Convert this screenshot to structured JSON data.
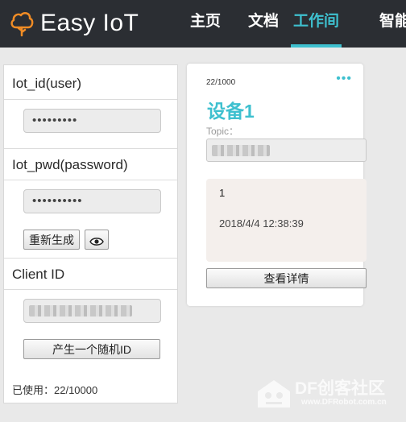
{
  "app": {
    "name": "Easy IoT"
  },
  "nav": {
    "items": [
      {
        "label": "主页"
      },
      {
        "label": "文档"
      },
      {
        "label": "工作间",
        "active": true
      },
      {
        "label": "智能"
      }
    ]
  },
  "credentials": {
    "iot_id_label": "Iot_id(user)",
    "iot_id_value": "•••••••••",
    "iot_pwd_label": "Iot_pwd(password)",
    "iot_pwd_value": "••••••••••",
    "regenerate_label": "重新生成",
    "show_icon": "eye-icon",
    "client_id_label": "Client ID",
    "random_id_button": "产生一个随机ID",
    "usage": "已使用：22/10000"
  },
  "device_card": {
    "counter": "22/1000",
    "menu_icon": "more-dots-icon",
    "name": "设备1",
    "topic_label": "Topic：",
    "message_value": "1",
    "message_time": "2018/4/4 12:38:39",
    "details_button": "查看详情"
  },
  "watermark": {
    "brand": "DF创客社区",
    "url": "www.DFRobot.com.cn"
  },
  "colors": {
    "accent": "#3ec0cf",
    "topbar": "#2b2e33",
    "background": "#e9e9e9",
    "message_panel": "#f4efec"
  }
}
